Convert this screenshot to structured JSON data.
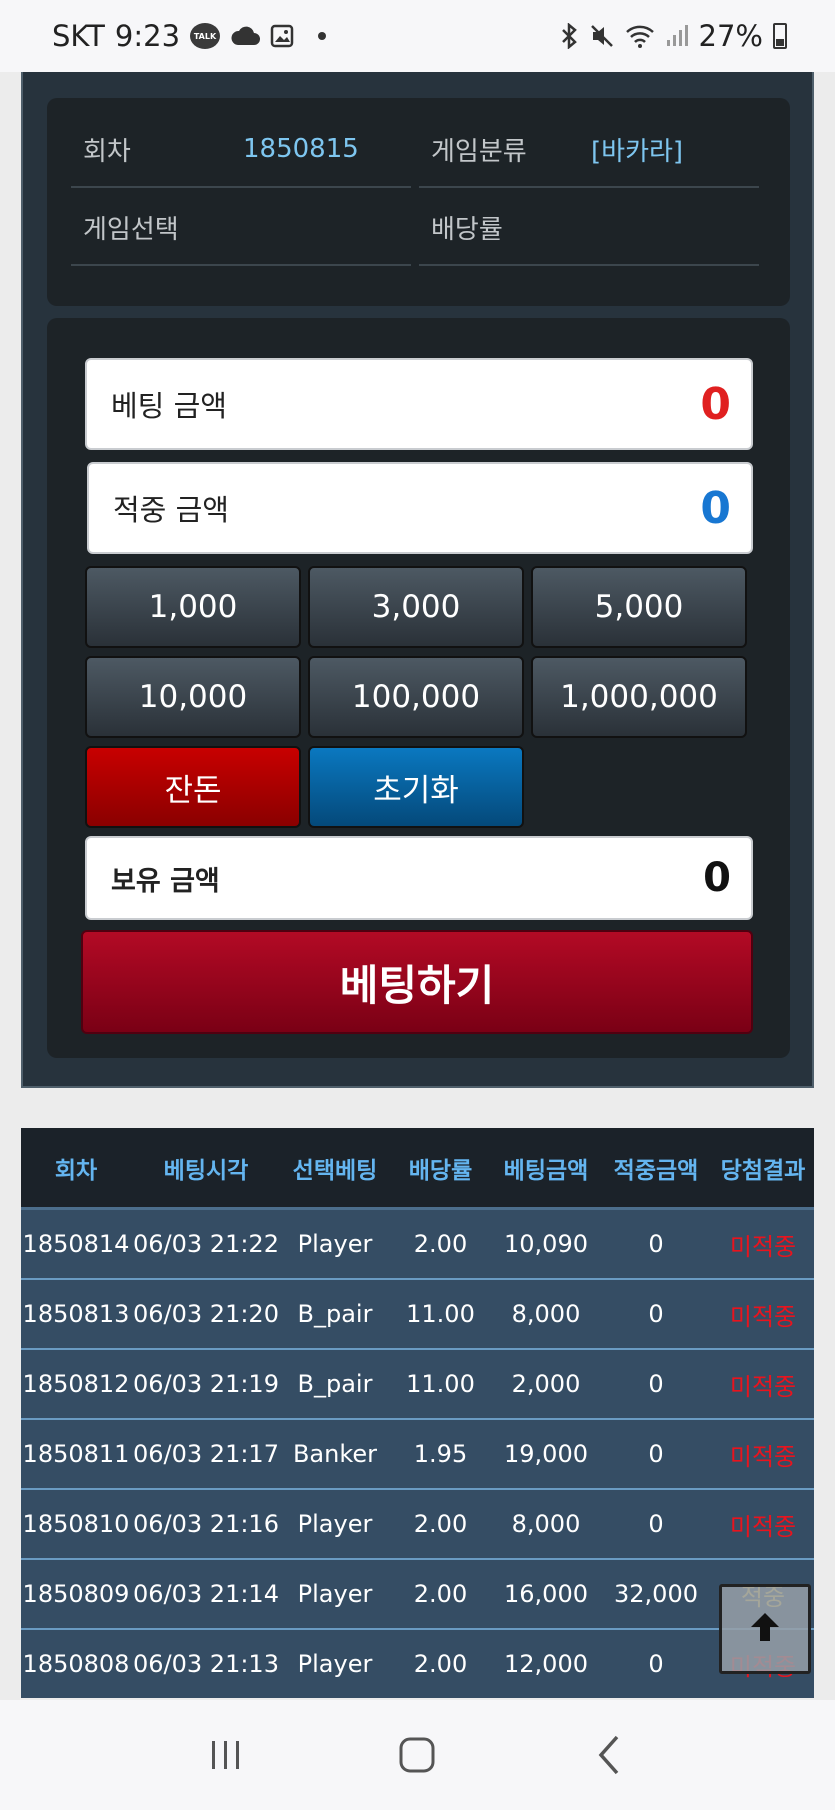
{
  "status_bar": {
    "carrier": "SKT",
    "time": "9:23",
    "battery": "27%",
    "icons": [
      "kakaotalk-icon",
      "cloud-icon",
      "gallery-icon",
      "dot-icon",
      "bluetooth-icon",
      "mute-icon",
      "wifi-icon",
      "signal-icon",
      "battery-icon"
    ],
    "talk_label": "TALK"
  },
  "game_info": {
    "round_label": "회차",
    "round_value": "1850815",
    "category_label": "게임분류",
    "category_value": "[바카라]",
    "select_label": "게임선택",
    "odds_label": "배당률"
  },
  "bet_panel": {
    "bet_amount_label": "베팅 금액",
    "bet_amount_value": "0",
    "win_amount_label": "적중 금액",
    "win_amount_value": "0",
    "chips": [
      "1,000",
      "3,000",
      "5,000",
      "10,000",
      "100,000",
      "1,000,000"
    ],
    "change_label": "잔돈",
    "reset_label": "초기화",
    "balance_label": "보유 금액",
    "balance_value": "0",
    "submit_label": "베팅하기",
    "colors": {
      "bet_amount": "#e02020",
      "win_amount": "#1877d2"
    }
  },
  "history": {
    "headers": [
      "회차",
      "베팅시각",
      "선택베팅",
      "배당률",
      "베팅금액",
      "적중금액",
      "당첨결과"
    ],
    "rows": [
      [
        "1850814",
        "06/03 21:22",
        "Player",
        "2.00",
        "10,090",
        "0",
        "미적중"
      ],
      [
        "1850813",
        "06/03 21:20",
        "B_pair",
        "11.00",
        "8,000",
        "0",
        "미적중"
      ],
      [
        "1850812",
        "06/03 21:19",
        "B_pair",
        "11.00",
        "2,000",
        "0",
        "미적중"
      ],
      [
        "1850811",
        "06/03 21:17",
        "Banker",
        "1.95",
        "19,000",
        "0",
        "미적중"
      ],
      [
        "1850810",
        "06/03 21:16",
        "Player",
        "2.00",
        "8,000",
        "0",
        "미적중"
      ],
      [
        "1850809",
        "06/03 21:14",
        "Player",
        "2.00",
        "16,000",
        "32,000",
        "적중"
      ],
      [
        "1850808",
        "06/03 21:13",
        "Player",
        "2.00",
        "12,000",
        "0",
        "미적중"
      ]
    ]
  },
  "scroll_top_icon": "arrow-up-icon",
  "nav_bar": {
    "icons": [
      "recent-apps-icon",
      "home-icon",
      "back-icon"
    ]
  }
}
